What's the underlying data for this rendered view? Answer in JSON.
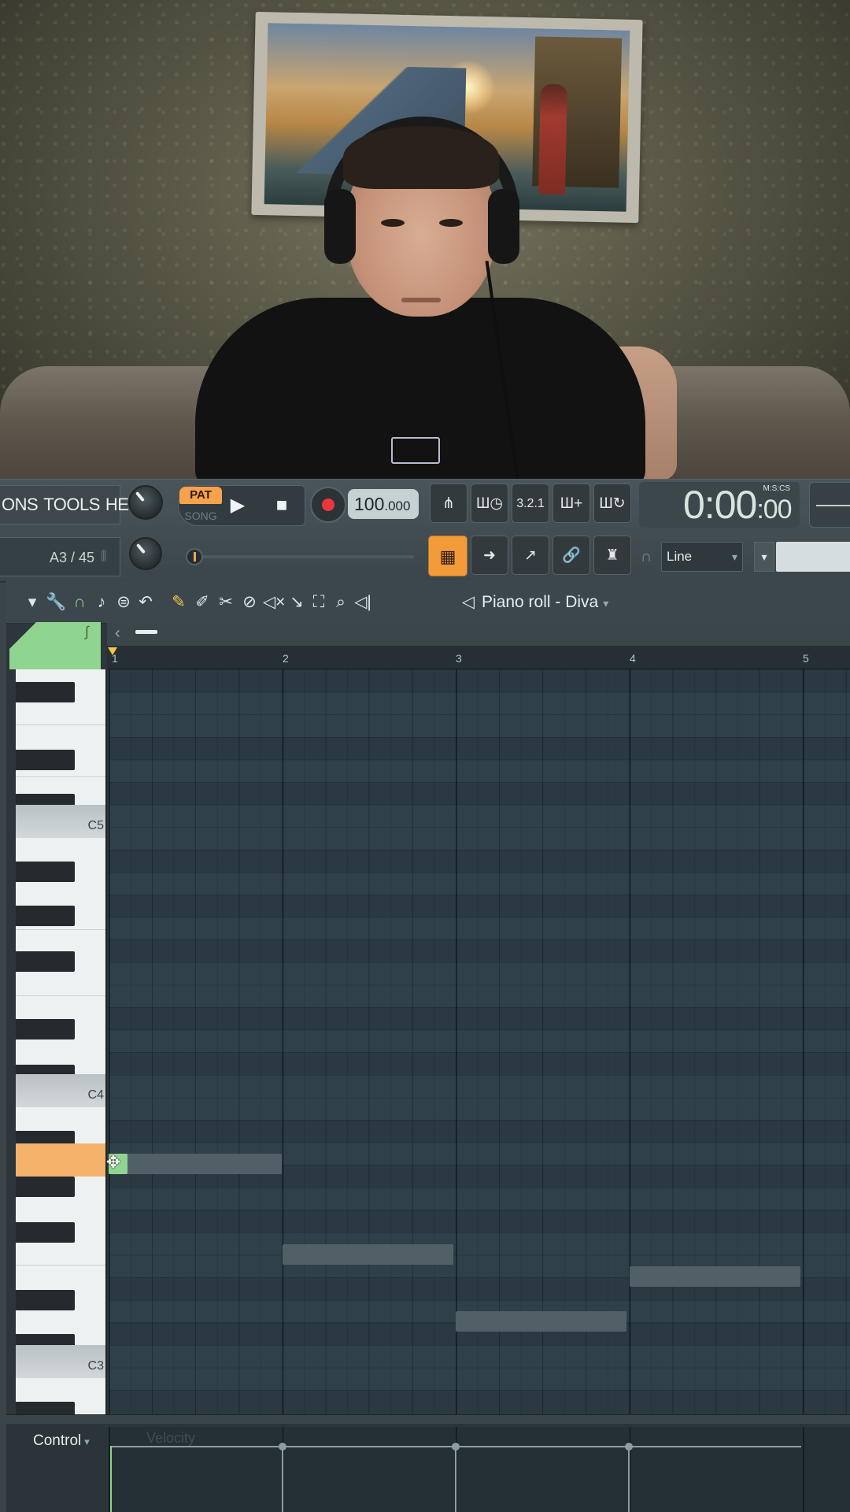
{
  "menu": {
    "items": [
      "ONS",
      "TOOLS",
      "HELP"
    ]
  },
  "transport": {
    "pat_label": "PAT",
    "song_label": "SONG",
    "play_icon": "▶",
    "stop_icon": "■",
    "tempo_main": "100",
    "tempo_frac": ".000"
  },
  "time_display": {
    "main": "0:00",
    "frac": ":00",
    "format": "M:S:CS"
  },
  "hint_bar": {
    "text": "A3 / 45"
  },
  "toolbar_buttons": [
    "metronome-icon",
    "wait-record-icon",
    "countdown-icon",
    "step-edit-icon",
    "loop-record-icon"
  ],
  "toolbar_button_glyphs": [
    "⋔",
    "Ш◷",
    "3.2.1",
    "Ш+",
    "Ш↻"
  ],
  "secondary_toolbar": {
    "line_select": "Line"
  },
  "piano_roll": {
    "title": "Piano roll - Diva",
    "tool_icons": [
      "▾",
      "🔧",
      "∩",
      "♪",
      "⊜",
      "↶",
      "✎",
      "✐",
      "✂",
      "⊘",
      "◁×",
      "↘",
      "⛶",
      "⌕",
      "◁|"
    ],
    "bar_numbers": [
      "1",
      "2",
      "3",
      "4",
      "5"
    ],
    "key_labels": [
      "C5",
      "C4",
      "C3"
    ],
    "notes": [
      {
        "bar": 1,
        "pitch": "A3",
        "length_bars": 1
      },
      {
        "bar": 2,
        "pitch": "E3",
        "length_bars": 1
      },
      {
        "bar": 3,
        "pitch": "C3",
        "length_bars": 1
      },
      {
        "bar": 4,
        "pitch": "D3",
        "length_bars": 1
      }
    ]
  },
  "control": {
    "label": "Control",
    "lane": "Velocity"
  },
  "colors": {
    "accent_orange": "#f39a3b",
    "note_green": "#8fd48f",
    "note_gray": "#516067",
    "grid_bg": "#30404a"
  }
}
